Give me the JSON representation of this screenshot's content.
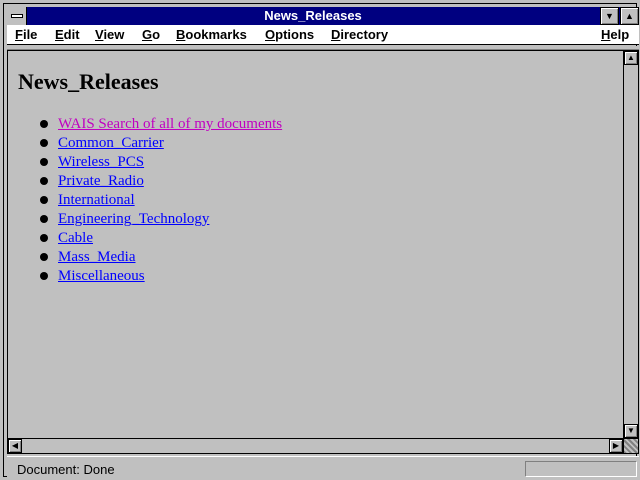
{
  "window": {
    "title": "News_Releases"
  },
  "menu": [
    {
      "label": "File",
      "accel": "F",
      "rest": "ile"
    },
    {
      "label": "Edit",
      "accel": "E",
      "rest": "dit"
    },
    {
      "label": "View",
      "accel": "V",
      "rest": "iew"
    },
    {
      "label": "Go",
      "accel": "G",
      "rest": "o"
    },
    {
      "label": "Bookmarks",
      "accel": "B",
      "rest": "ookmarks"
    },
    {
      "label": "Options",
      "accel": "O",
      "rest": "ptions"
    },
    {
      "label": "Directory",
      "accel": "D",
      "rest": "irectory"
    },
    {
      "label": "Help",
      "accel": "H",
      "rest": "elp"
    }
  ],
  "page": {
    "title": "News_Releases",
    "links": [
      {
        "text": "WAIS Search of all of my documents",
        "visited": true
      },
      {
        "text": "Common_Carrier",
        "visited": false
      },
      {
        "text": "Wireless_PCS",
        "visited": false
      },
      {
        "text": "Private_Radio",
        "visited": false
      },
      {
        "text": "International",
        "visited": false
      },
      {
        "text": "Engineering_Technology",
        "visited": false
      },
      {
        "text": "Cable",
        "visited": false
      },
      {
        "text": "Mass_Media",
        "visited": false
      },
      {
        "text": "Miscellaneous",
        "visited": false
      }
    ]
  },
  "status": {
    "text": "Document: Done"
  },
  "icons": {
    "system_menu": "system-menu-icon",
    "minimize": "triangle-down",
    "maximize": "triangle-up",
    "scroll_up": "triangle-up",
    "scroll_down": "triangle-down",
    "scroll_left": "triangle-left",
    "scroll_right": "triangle-right"
  },
  "colors": {
    "titlebar": "#000080",
    "link": "#0000ff",
    "visited_link": "#c000c0",
    "face": "#c0c0c0"
  }
}
